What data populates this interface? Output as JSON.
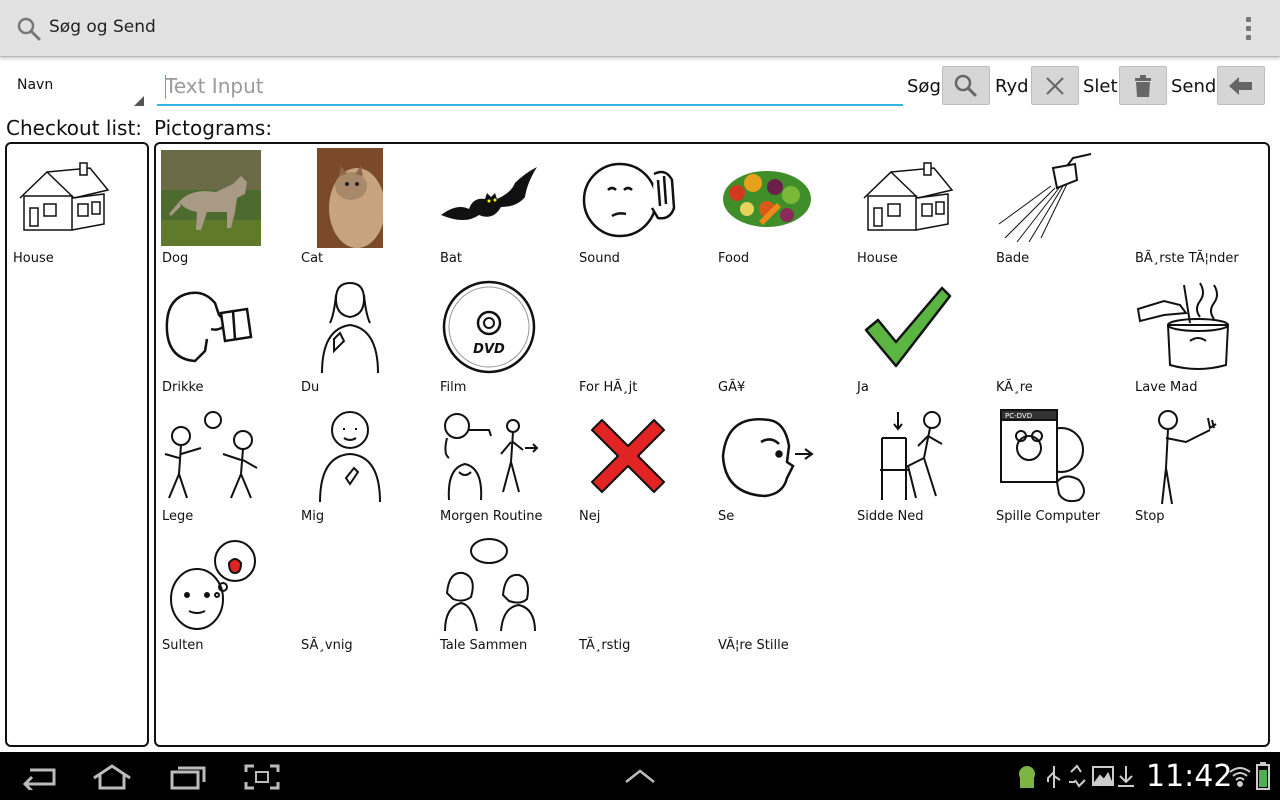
{
  "app": {
    "title": "Søg og Send"
  },
  "toolbar": {
    "sort_value": "Navn",
    "search_placeholder": "Text Input",
    "search_value": "",
    "search_label": "Søg",
    "clear_label": "Ryd",
    "delete_label": "Slet",
    "send_label": "Send"
  },
  "checkout": {
    "heading": "Checkout list:",
    "items": [
      {
        "name": "House",
        "icon": "house-icon"
      }
    ]
  },
  "pictograms": {
    "heading": "Pictograms:",
    "items": [
      {
        "name": "Dog",
        "icon": "dog-photo"
      },
      {
        "name": "Cat",
        "icon": "cat-photo"
      },
      {
        "name": "Bat",
        "icon": "bat-icon"
      },
      {
        "name": "Sound",
        "icon": "listening-face-icon"
      },
      {
        "name": "Food",
        "icon": "vegetables-icon"
      },
      {
        "name": "House",
        "icon": "house-icon"
      },
      {
        "name": "Bade",
        "icon": "shower-icon"
      },
      {
        "name": "BÃ¸rste TÃ¦nder",
        "icon": "brush-teeth-icon"
      },
      {
        "name": "Drikke",
        "icon": "drinking-icon"
      },
      {
        "name": "Du",
        "icon": "pointing-person-icon"
      },
      {
        "name": "Film",
        "icon": "dvd-icon"
      },
      {
        "name": "For HÃ¸jt",
        "icon": ""
      },
      {
        "name": "GÃ¥",
        "icon": ""
      },
      {
        "name": "Ja",
        "icon": "checkmark-icon"
      },
      {
        "name": "KÃ¸re",
        "icon": ""
      },
      {
        "name": "Lave Mad",
        "icon": "cooking-pot-icon"
      },
      {
        "name": "Lege",
        "icon": "children-playing-icon"
      },
      {
        "name": "Mig",
        "icon": "me-person-icon"
      },
      {
        "name": "Morgen Routine",
        "icon": "morning-routine-icon"
      },
      {
        "name": "Nej",
        "icon": "red-cross-icon"
      },
      {
        "name": "Se",
        "icon": "looking-face-icon"
      },
      {
        "name": "Sidde Ned",
        "icon": "sit-down-icon"
      },
      {
        "name": "Spille Computer",
        "icon": "pc-dvd-icon"
      },
      {
        "name": "Stop",
        "icon": "stop-hand-icon"
      },
      {
        "name": "Sulten",
        "icon": "hungry-face-icon"
      },
      {
        "name": "SÃ¸vnig",
        "icon": ""
      },
      {
        "name": "Tale Sammen",
        "icon": "talking-people-icon"
      },
      {
        "name": "TÃ¸rstig",
        "icon": ""
      },
      {
        "name": "VÃ¦re Stille",
        "icon": ""
      }
    ]
  },
  "statusbar": {
    "time": "11:42"
  },
  "colors": {
    "accent": "#33b5e5",
    "actionbar": "#e2e2e2",
    "navbar": "#000000",
    "check": "#5bb543",
    "cross": "#e02424"
  }
}
